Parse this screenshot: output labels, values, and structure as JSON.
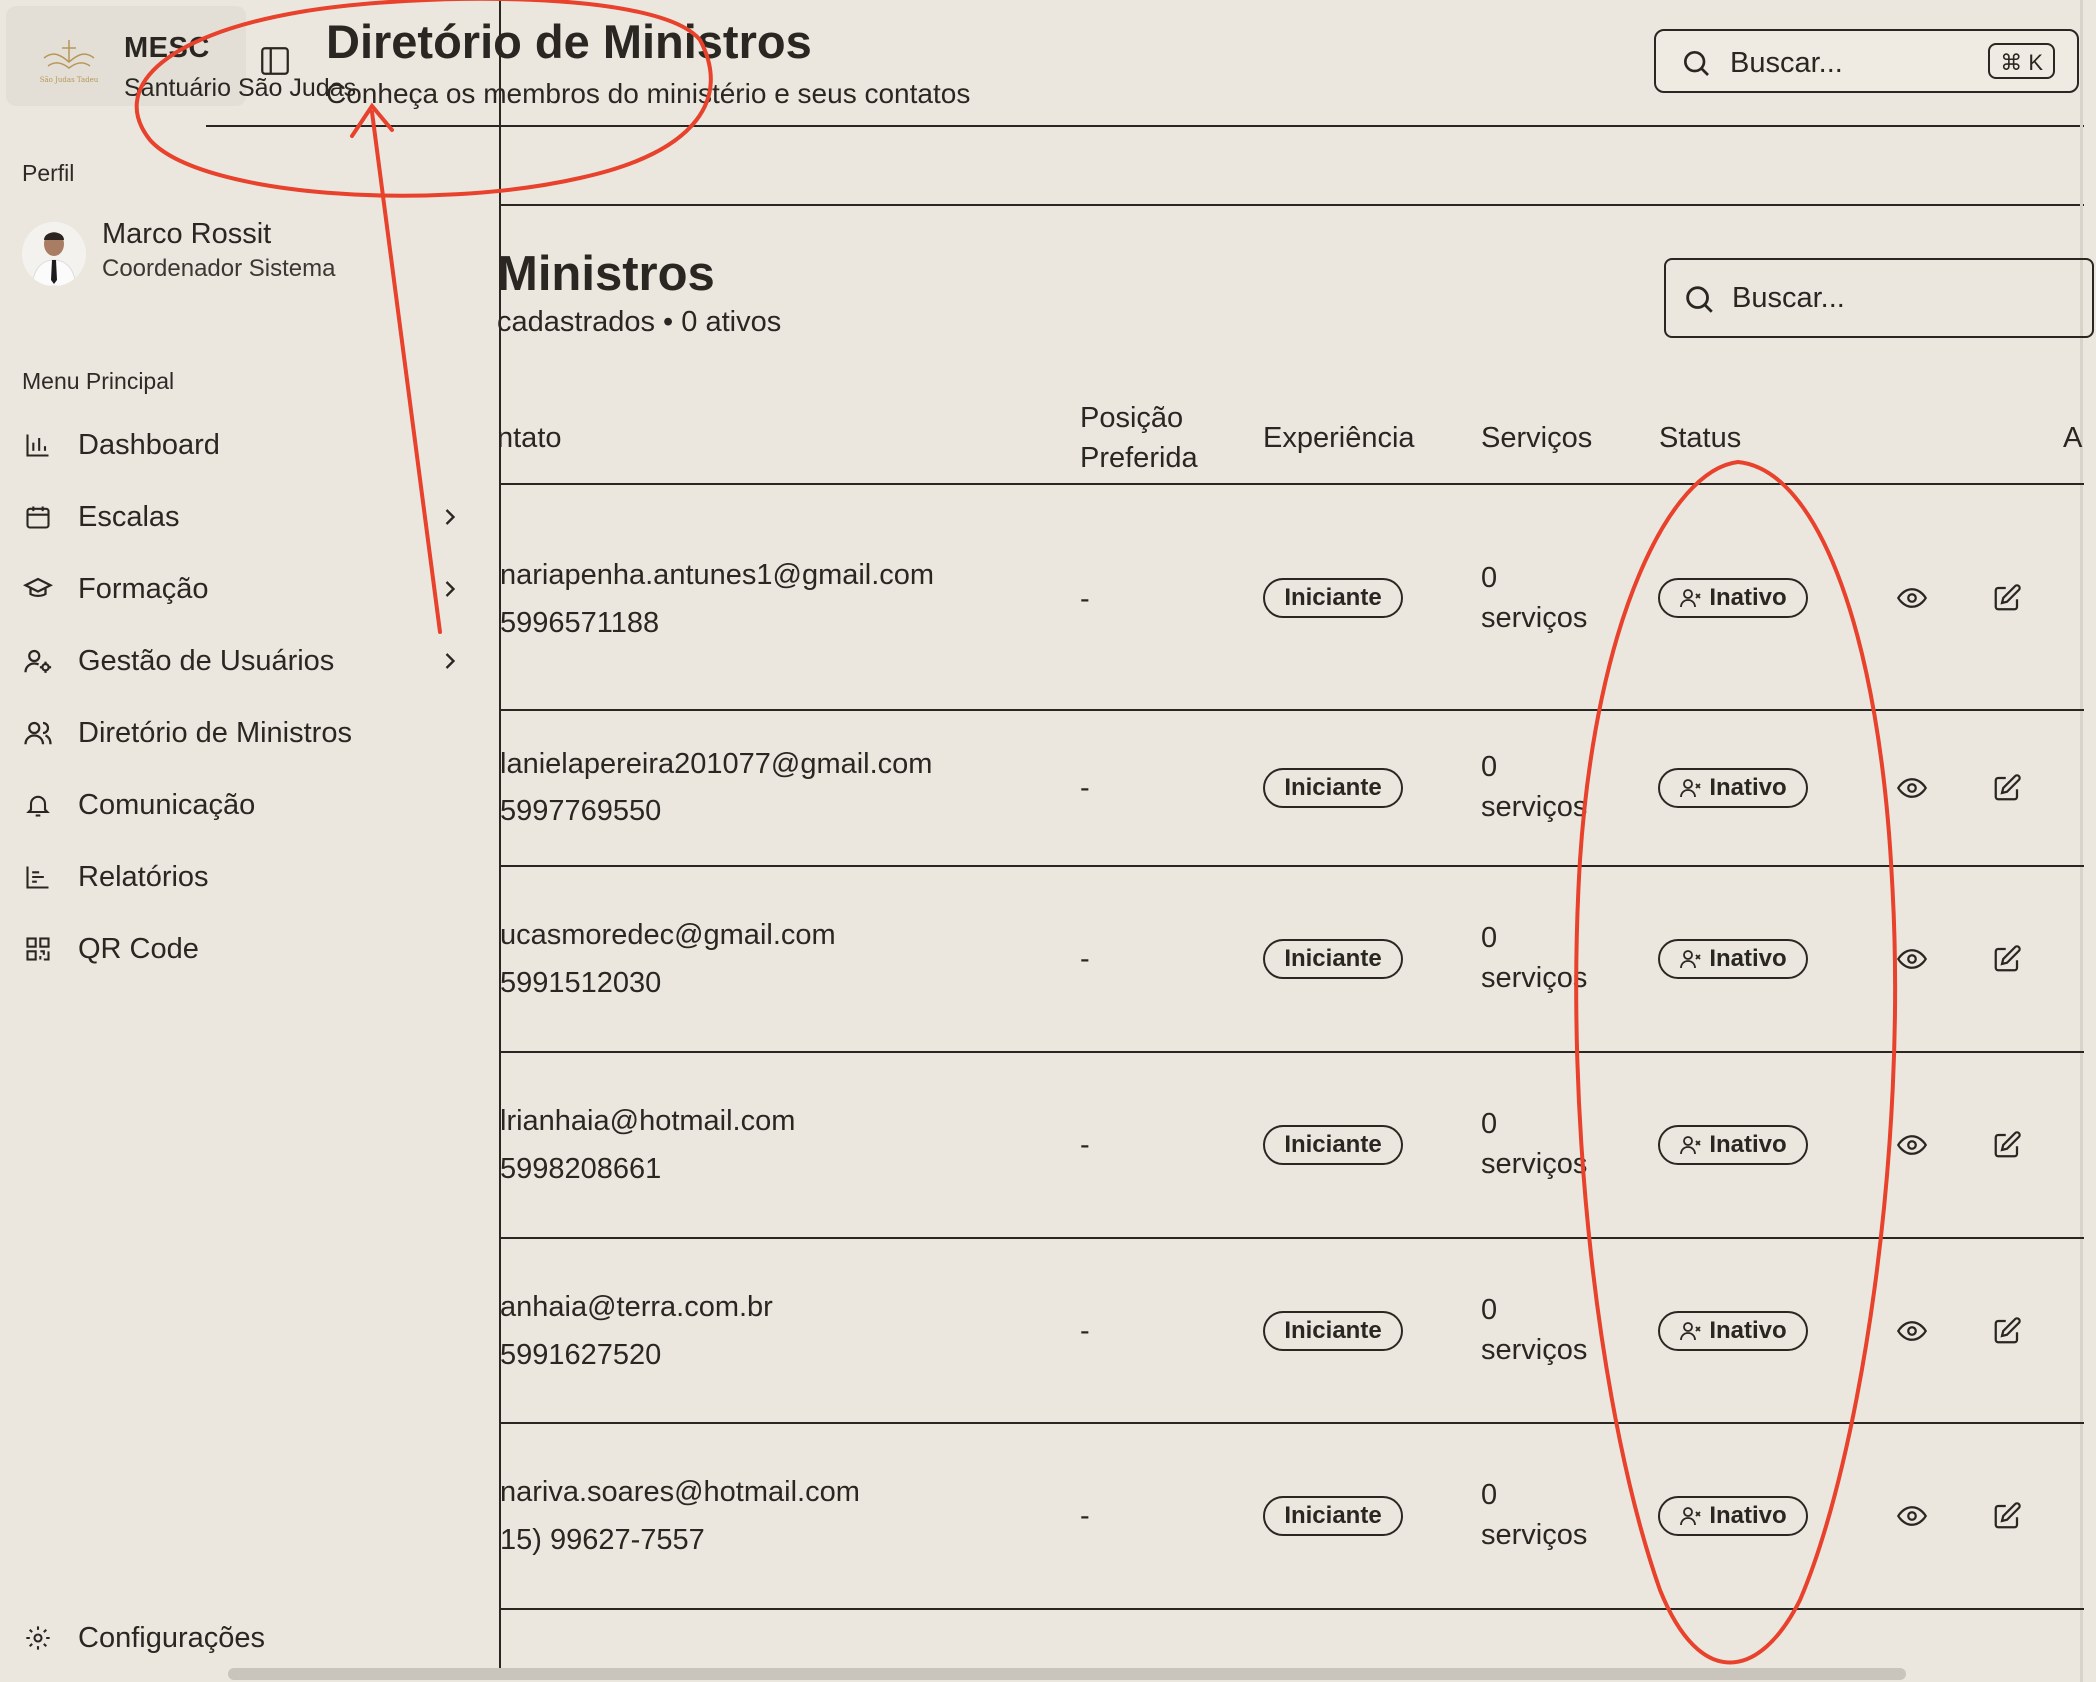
{
  "brand": {
    "name": "MESC",
    "subtitle": "Santuário São Judas",
    "logo_text": "São Judas Tadeu"
  },
  "header": {
    "title": "Diretório de Ministros",
    "subtitle": "Conheça os membros do ministério e seus contatos"
  },
  "top_search": {
    "placeholder": "Buscar...",
    "shortcut": "⌘ K"
  },
  "sidebar": {
    "profile_section_label": "Perfil",
    "profile": {
      "name": "Marco Rossit",
      "role": "Coordenador Sistema"
    },
    "menu_label": "Menu Principal",
    "items": [
      {
        "label": "Dashboard",
        "icon": "bar-chart-icon",
        "has_submenu": false
      },
      {
        "label": "Escalas",
        "icon": "calendar-icon",
        "has_submenu": true
      },
      {
        "label": "Formação",
        "icon": "graduation-cap-icon",
        "has_submenu": true
      },
      {
        "label": "Gestão de Usuários",
        "icon": "user-cog-icon",
        "has_submenu": true
      },
      {
        "label": "Diretório de Ministros",
        "icon": "users-icon",
        "has_submenu": false
      },
      {
        "label": "Comunicação",
        "icon": "bell-icon",
        "has_submenu": false
      },
      {
        "label": "Relatórios",
        "icon": "line-chart-icon",
        "has_submenu": false
      },
      {
        "label": "QR Code",
        "icon": "qr-code-icon",
        "has_submenu": false
      }
    ],
    "settings_label": "Configurações"
  },
  "card": {
    "title": "Ministros",
    "subtitle": "cadastrados • 0 ativos",
    "search_placeholder": "Buscar..."
  },
  "table": {
    "columns": {
      "contact": "ntato",
      "position_line1": "Posição",
      "position_line2": "Preferida",
      "experience": "Experiência",
      "services": "Serviços",
      "status": "Status",
      "actions": "A"
    },
    "rows": [
      {
        "email": "nariapenha.antunes1@gmail.com",
        "phone": "5996571188",
        "position": "-",
        "experience": "Iniciante",
        "services_count": "0",
        "services_unit": "serviços",
        "status": "Inativo"
      },
      {
        "email": "lanielapereira201077@gmail.com",
        "phone": "5997769550",
        "position": "-",
        "experience": "Iniciante",
        "services_count": "0",
        "services_unit": "serviços",
        "status": "Inativo"
      },
      {
        "email": "ucasmoredec@gmail.com",
        "phone": "5991512030",
        "position": "-",
        "experience": "Iniciante",
        "services_count": "0",
        "services_unit": "serviços",
        "status": "Inativo"
      },
      {
        "email": "lrianhaia@hotmail.com",
        "phone": "5998208661",
        "position": "-",
        "experience": "Iniciante",
        "services_count": "0",
        "services_unit": "serviços",
        "status": "Inativo"
      },
      {
        "email": "anhaia@terra.com.br",
        "phone": "5991627520",
        "position": "-",
        "experience": "Iniciante",
        "services_count": "0",
        "services_unit": "serviços",
        "status": "Inativo"
      },
      {
        "email": "nariva.soares@hotmail.com",
        "phone": "15) 99627-7557",
        "position": "-",
        "experience": "Iniciante",
        "services_count": "0",
        "services_unit": "serviços",
        "status": "Inativo"
      }
    ]
  },
  "annotation": {
    "color": "#e8412c"
  }
}
